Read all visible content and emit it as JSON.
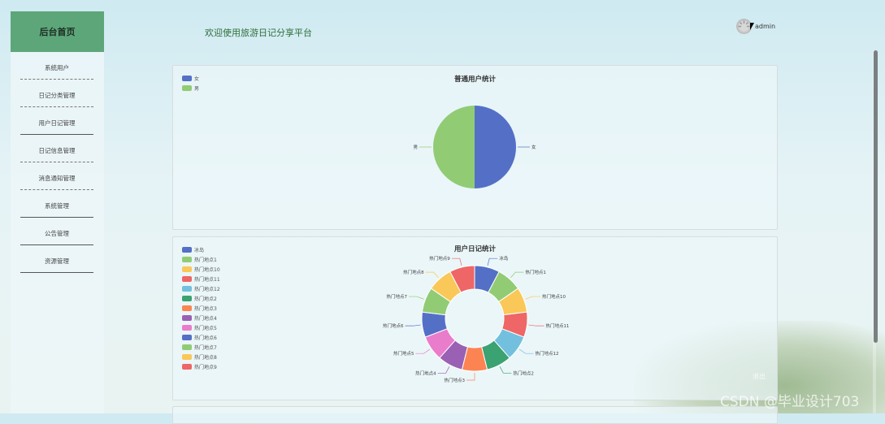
{
  "sidebar": {
    "title": "后台首页",
    "items": [
      {
        "label": "系统用户"
      },
      {
        "label": "日记分类管理"
      },
      {
        "label": "用户日记管理"
      },
      {
        "label": "日记信息管理"
      },
      {
        "label": "消息通知管理"
      },
      {
        "label": "系统管理"
      },
      {
        "label": "公告管理"
      },
      {
        "label": "资源管理"
      }
    ]
  },
  "header": {
    "welcome": "欢迎使用旅游日记分享平台",
    "username": "admin"
  },
  "overlay": {
    "logout": "退出",
    "watermark": "CSDN @毕业设计703"
  },
  "charts": {
    "users": {
      "title": "普通用户统计"
    },
    "diary": {
      "title": "用户日记统计"
    }
  },
  "chart_data": [
    {
      "type": "pie",
      "title": "普通用户统计",
      "categories": [
        "女",
        "男"
      ],
      "values": [
        1,
        1
      ],
      "colors": [
        "#5470c6",
        "#91cc75"
      ],
      "legend": "top-left"
    },
    {
      "type": "pie",
      "title": "用户日记统计",
      "donut": true,
      "categories": [
        "冰岛",
        "热门地点1",
        "热门地点10",
        "热门地点11",
        "热门地点12",
        "热门地点2",
        "热门地点3",
        "热门地点4",
        "热门地点5",
        "热门地点6",
        "热门地点7",
        "热门地点8",
        "热门地点9"
      ],
      "values": [
        1,
        1,
        1,
        1,
        1,
        1,
        1,
        1,
        1,
        1,
        1,
        1,
        1
      ],
      "colors": [
        "#5470c6",
        "#91cc75",
        "#fac858",
        "#ee6666",
        "#73c0de",
        "#3ba272",
        "#fc8452",
        "#9a60b4",
        "#ea7ccc",
        "#5470c6",
        "#91cc75",
        "#fac858",
        "#ee6666"
      ],
      "legend": "top-left"
    }
  ]
}
